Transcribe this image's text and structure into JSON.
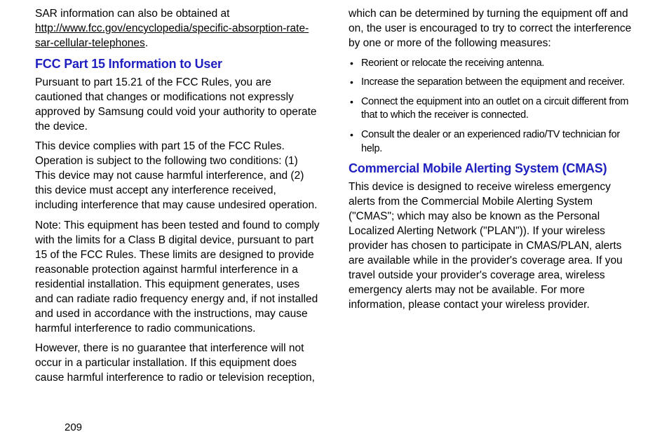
{
  "left": {
    "intro_text": "SAR information can also be obtained at ",
    "link_text": "http://www.fcc.gov/encyclopedia/specific-absorption-rate-sar-cellular-telephones",
    "intro_suffix": ".",
    "heading1": "FCC Part 15 Information to User",
    "para1": "Pursuant to part 15.21 of the FCC Rules, you are cautioned that changes or modifications not expressly approved by Samsung could void your authority to operate the device.",
    "para2": "This device complies with part 15 of the FCC Rules. Operation is subject to the following two conditions: (1) This device may not cause harmful interference, and (2) this device must accept any interference received, including interference that may cause undesired operation.",
    "para3": "Note: This equipment has been tested and found to comply with the limits for a Class B digital device, pursuant to part 15 of the FCC Rules. These limits are designed to provide reasonable protection against harmful interference in a residential installation. This equipment generates, uses and can radiate radio frequency energy and, if not installed and used in accordance with the instructions, may cause harmful interference to radio communications.",
    "para4": "However, there is no guarantee that interference will not occur in a particular installation. If this equipment does cause harmful interference to radio or television reception,"
  },
  "right": {
    "para_cont": "which can be determined by turning the equipment off and on, the user is encouraged to try to correct the interference by one or more of the following measures:",
    "bullets": [
      "Reorient or relocate the receiving antenna.",
      "Increase the separation between the equipment and receiver.",
      "Connect the equipment into an outlet on a circuit different from that to which the receiver is connected.",
      "Consult the dealer or an experienced radio/TV technician for help."
    ],
    "heading2": "Commercial Mobile Alerting System (CMAS)",
    "para5": "This device is designed to receive wireless emergency alerts from the Commercial Mobile Alerting System (\"CMAS\"; which may also be known as the Personal Localized Alerting Network (\"PLAN\")). If your wireless provider has chosen to participate in CMAS/PLAN, alerts are available while in the provider's coverage area. If you travel outside your provider's coverage area, wireless emergency alerts may not be available. For more information, please contact your wireless provider."
  },
  "page_number": "209"
}
